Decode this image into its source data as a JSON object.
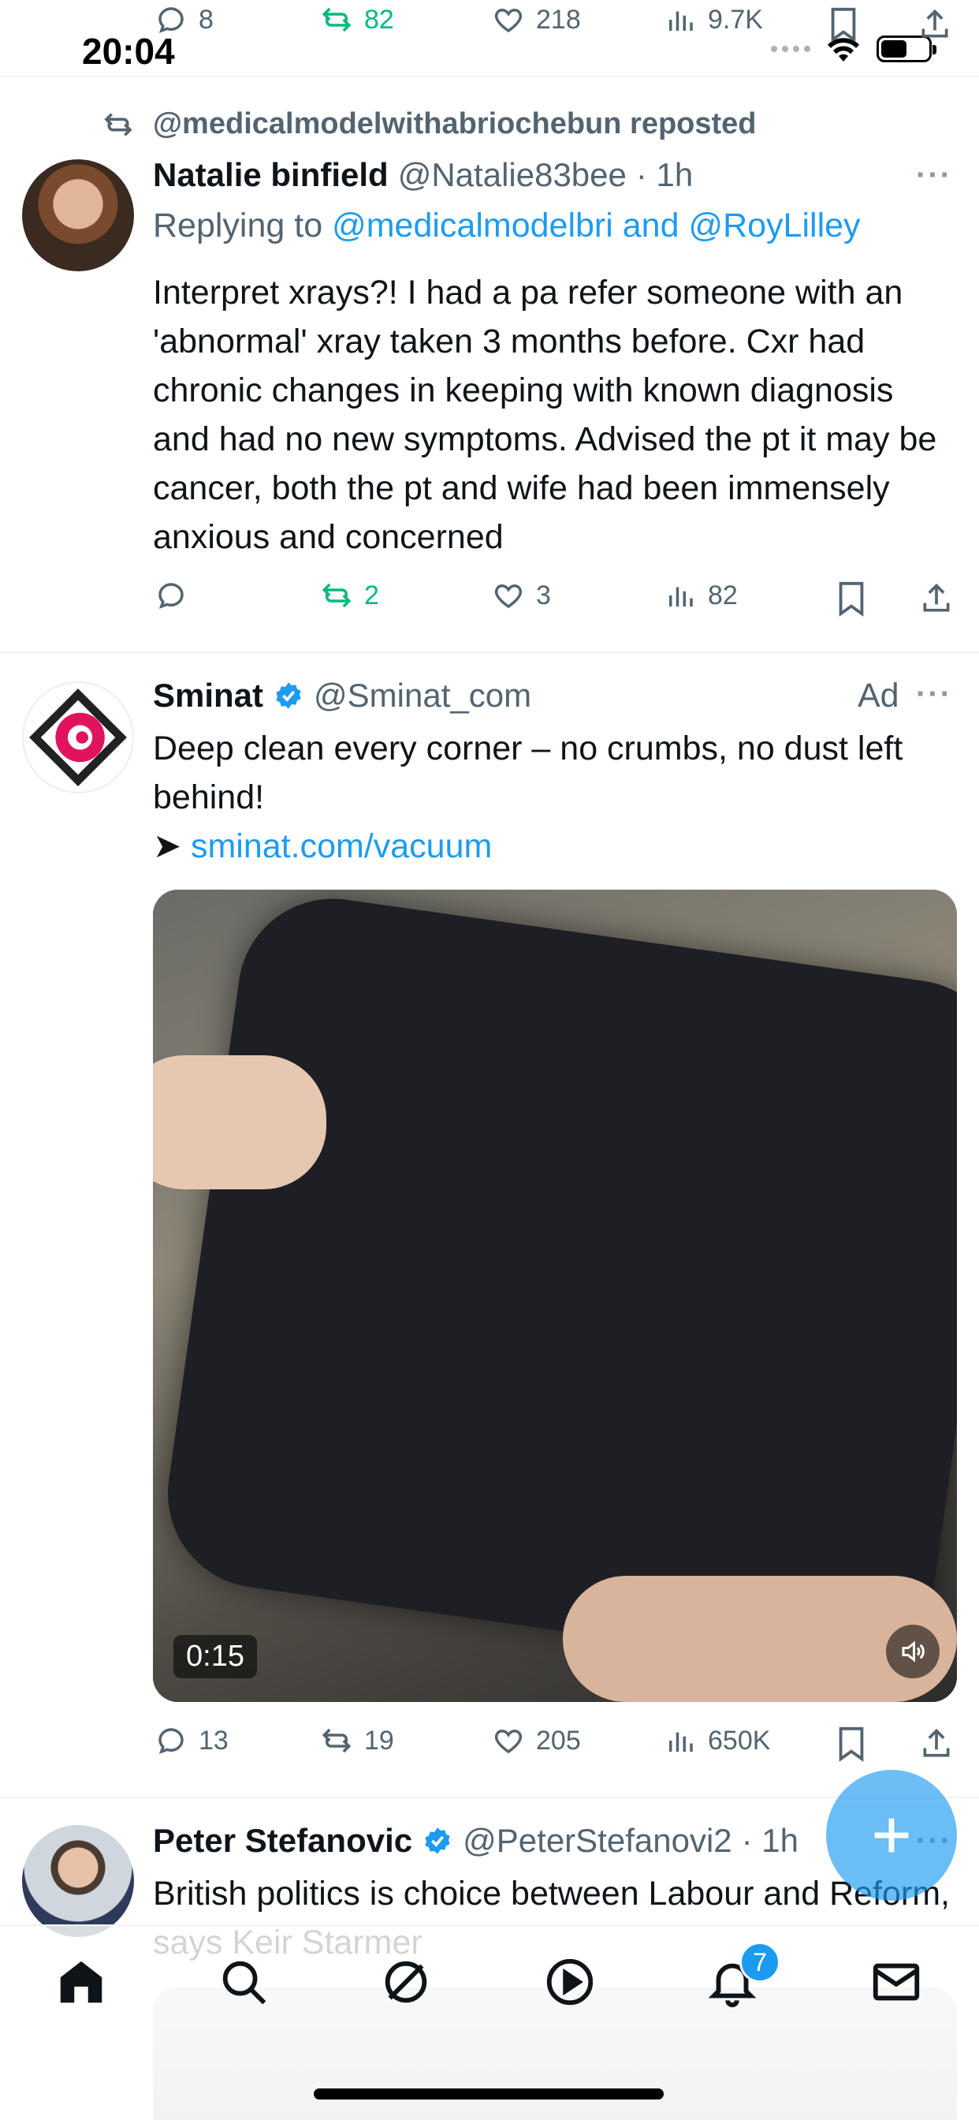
{
  "status_bar": {
    "time": "20:04"
  },
  "prev_tweet_actions": {
    "replies": "8",
    "reposts": "82",
    "likes": "218",
    "views": "9.7K"
  },
  "tweet1": {
    "repost_label": "@medicalmodelwithabriochebun reposted",
    "name": "Natalie binfield",
    "handle": "@Natalie83bee",
    "time": "· 1h",
    "replying_prefix": "Replying to ",
    "replying_users": "@medicalmodelbri and @RoyLilley",
    "text": "Interpret xrays?! I had a pa refer someone with an 'abnormal' xray taken 3 months before. Cxr had chronic changes in keeping with known diagnosis and had no new symptoms. Advised the pt it may be cancer, both the pt and wife had been immensely anxious and concerned",
    "reposts": "2",
    "likes": "3",
    "views": "82"
  },
  "tweet2": {
    "name": "Sminat",
    "handle": "@Sminat_com",
    "ad_label": "Ad",
    "text": "Deep clean every corner – no crumbs, no dust left behind!",
    "arrow": "➤ ",
    "link": "sminat.com/vacuum",
    "video_duration": "0:15",
    "replies": "13",
    "reposts": "19",
    "likes": "205",
    "views": "650K"
  },
  "tweet3": {
    "name": "Peter Stefanovic",
    "handle": "@PeterStefanovi2",
    "time": "· 1h",
    "text": "British politics is choice between Labour and Reform, says Keir Starmer"
  },
  "bottom_nav": {
    "notifications_badge": "7"
  },
  "colors": {
    "accent": "#1d9bf0",
    "repost_green": "#00ba7c",
    "muted": "#536471"
  }
}
